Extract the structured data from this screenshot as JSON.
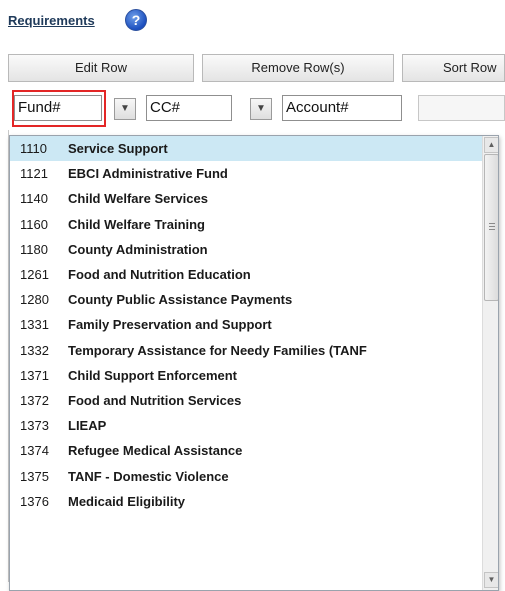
{
  "section": {
    "title": "Requirements",
    "help_icon": "question-circle-icon"
  },
  "toolbar": {
    "edit_row": "Edit Row",
    "remove_rows": "Remove Row(s)",
    "sort_rows": "Sort Row"
  },
  "filters": {
    "fund": "Fund#",
    "cc": "CC#",
    "account": "Account#",
    "dropdown_icon": "chevron-down-icon"
  },
  "dropdown": {
    "selected_index": 0,
    "items": [
      {
        "code": "1110",
        "name": "Service Support"
      },
      {
        "code": "1121",
        "name": "EBCI Administrative Fund"
      },
      {
        "code": "1140",
        "name": "Child Welfare Services"
      },
      {
        "code": "1160",
        "name": "Child Welfare Training"
      },
      {
        "code": "1180",
        "name": "County Administration"
      },
      {
        "code": "1261",
        "name": "Food and Nutrition Education"
      },
      {
        "code": "1280",
        "name": "County Public Assistance Payments"
      },
      {
        "code": "1331",
        "name": "Family Preservation and Support"
      },
      {
        "code": "1332",
        "name": "Temporary Assistance for Needy Families (TANF"
      },
      {
        "code": "1371",
        "name": "Child Support Enforcement"
      },
      {
        "code": "1372",
        "name": "Food and Nutrition Services"
      },
      {
        "code": "1373",
        "name": "LIEAP"
      },
      {
        "code": "1374",
        "name": "Refugee Medical Assistance"
      },
      {
        "code": "1375",
        "name": "TANF - Domestic Violence"
      },
      {
        "code": "1376",
        "name": "Medicaid Eligibility"
      }
    ]
  },
  "colors": {
    "selected_row": "#cce8f4",
    "highlight_border": "#e32626",
    "title": "#1f3a5a"
  }
}
